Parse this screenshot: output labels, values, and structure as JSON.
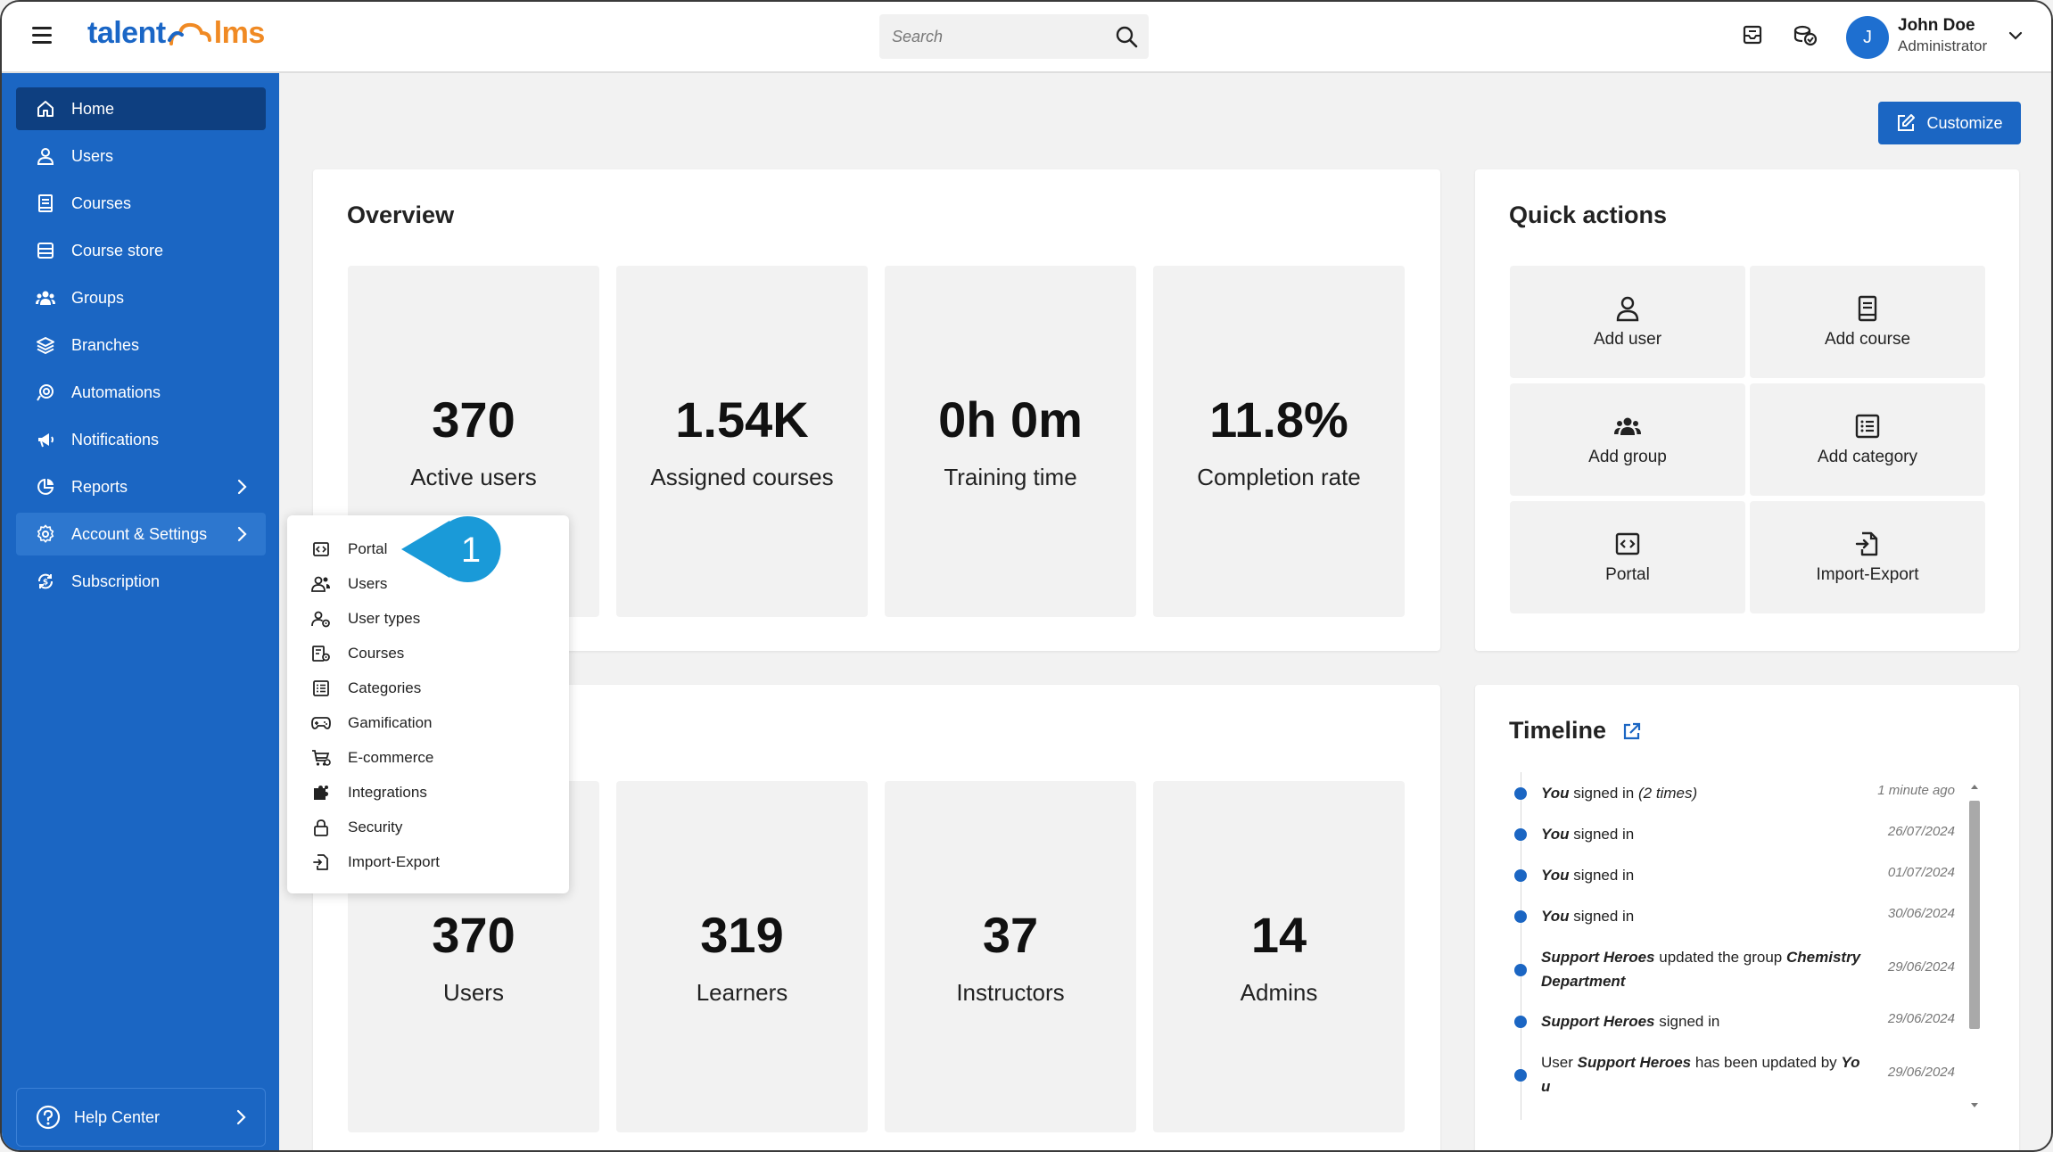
{
  "header": {
    "logo_left": "talent",
    "logo_right": "lms",
    "search_placeholder": "Search",
    "user": {
      "initial": "J",
      "name": "John Doe",
      "role": "Administrator"
    }
  },
  "sidebar": {
    "items": [
      {
        "label": "Home",
        "icon": "home-icon"
      },
      {
        "label": "Users",
        "icon": "user-icon"
      },
      {
        "label": "Courses",
        "icon": "book-icon"
      },
      {
        "label": "Course store",
        "icon": "store-icon"
      },
      {
        "label": "Groups",
        "icon": "group-icon"
      },
      {
        "label": "Branches",
        "icon": "layers-icon"
      },
      {
        "label": "Automations",
        "icon": "automation-icon"
      },
      {
        "label": "Notifications",
        "icon": "megaphone-icon"
      },
      {
        "label": "Reports",
        "icon": "pie-chart-icon"
      },
      {
        "label": "Account & Settings",
        "icon": "gear-icon"
      },
      {
        "label": "Subscription",
        "icon": "subscription-icon"
      }
    ],
    "help": "Help Center"
  },
  "main": {
    "customize_label": "Customize",
    "overview": {
      "title": "Overview",
      "stats": [
        {
          "value": "370",
          "label": "Active users"
        },
        {
          "value": "1.54K",
          "label": "Assigned courses"
        },
        {
          "value": "0h 0m",
          "label": "Training time"
        },
        {
          "value": "11.8%",
          "label": "Completion rate"
        }
      ]
    },
    "users_card": {
      "stats": [
        {
          "value": "370",
          "label": "Users"
        },
        {
          "value": "319",
          "label": "Learners"
        },
        {
          "value": "37",
          "label": "Instructors"
        },
        {
          "value": "14",
          "label": "Admins"
        }
      ]
    },
    "quick_actions": {
      "title": "Quick actions",
      "items": [
        {
          "label": "Add user",
          "icon": "user-icon"
        },
        {
          "label": "Add course",
          "icon": "book-icon"
        },
        {
          "label": "Add group",
          "icon": "group-icon"
        },
        {
          "label": "Add category",
          "icon": "list-icon"
        },
        {
          "label": "Portal",
          "icon": "code-icon"
        },
        {
          "label": "Import-Export",
          "icon": "import-icon"
        }
      ]
    },
    "timeline": {
      "title": "Timeline",
      "events": [
        {
          "actor": "You",
          "text": " signed in ",
          "extra": "(2 times)",
          "time": "1 minute ago"
        },
        {
          "actor": "You",
          "text": " signed in",
          "extra": "",
          "time": "26/07/2024"
        },
        {
          "actor": "You",
          "text": " signed in",
          "extra": "",
          "time": "01/07/2024"
        },
        {
          "actor": "You",
          "text": " signed in",
          "extra": "",
          "time": "30/06/2024"
        },
        {
          "actor": "Support Heroes",
          "text": " updated the group ",
          "extra": "ChemistryDepartment",
          "time": "29/06/2024"
        },
        {
          "actor": "Support Heroes",
          "text": " signed in",
          "extra": "",
          "time": "29/06/2024"
        },
        {
          "prefix": "User ",
          "actor": "Support Heroes",
          "text": " has been updated by ",
          "extra": "You",
          "time": "29/06/2024"
        }
      ]
    }
  },
  "popup_menu": {
    "items": [
      {
        "label": "Portal",
        "icon": "code-icon"
      },
      {
        "label": "Users",
        "icon": "users-icon"
      },
      {
        "label": "User types",
        "icon": "user-types-icon"
      },
      {
        "label": "Courses",
        "icon": "courses-settings-icon"
      },
      {
        "label": "Categories",
        "icon": "list-icon"
      },
      {
        "label": "Gamification",
        "icon": "gamepad-icon"
      },
      {
        "label": "E-commerce",
        "icon": "cart-icon"
      },
      {
        "label": "Integrations",
        "icon": "puzzle-icon"
      },
      {
        "label": "Security",
        "icon": "lock-icon"
      },
      {
        "label": "Import-Export",
        "icon": "import-icon"
      }
    ]
  },
  "callout": {
    "number": "1",
    "color": "#1a9ad8"
  },
  "colors": {
    "primary": "#1b66c3",
    "active": "#0e3f80",
    "logo_orange": "#f08a24"
  }
}
